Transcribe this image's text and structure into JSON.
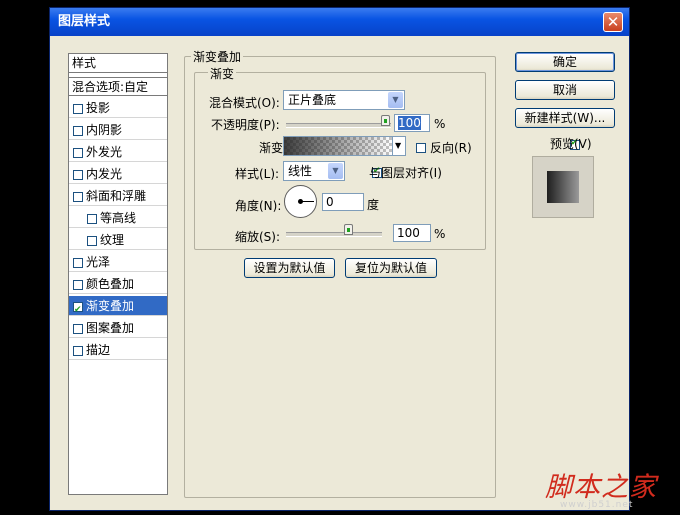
{
  "window": {
    "title": "图层样式",
    "close_glyph": "✕"
  },
  "styles_list": {
    "header": "样式",
    "blend_options": "混合选项:自定",
    "items": [
      {
        "label": "投影",
        "checked": false,
        "sub": false
      },
      {
        "label": "内阴影",
        "checked": false,
        "sub": false
      },
      {
        "label": "外发光",
        "checked": false,
        "sub": false
      },
      {
        "label": "内发光",
        "checked": false,
        "sub": false
      },
      {
        "label": "斜面和浮雕",
        "checked": false,
        "sub": false
      },
      {
        "label": "等高线",
        "checked": false,
        "sub": true
      },
      {
        "label": "纹理",
        "checked": false,
        "sub": true
      },
      {
        "label": "光泽",
        "checked": false,
        "sub": false
      },
      {
        "label": "颜色叠加",
        "checked": false,
        "sub": false
      },
      {
        "label": "渐变叠加",
        "checked": true,
        "sub": false,
        "selected": true
      },
      {
        "label": "图案叠加",
        "checked": false,
        "sub": false
      },
      {
        "label": "描边",
        "checked": false,
        "sub": false
      }
    ]
  },
  "panel": {
    "group_title": "渐变叠加",
    "inner_group_title": "渐变",
    "blend_mode_label": "混合模式(O):",
    "blend_mode_value": "正片叠底",
    "opacity_label": "不透明度(P):",
    "opacity_value": "100",
    "opacity_unit": "%",
    "gradient_label": "渐变:",
    "reverse_label": "反向(R)",
    "reverse_checked": false,
    "style_label": "样式(L):",
    "style_value": "线性",
    "align_label": "与图层对齐(I)",
    "align_checked": true,
    "angle_label": "角度(N):",
    "angle_value": "0",
    "angle_unit": "度",
    "scale_label": "缩放(S):",
    "scale_value": "100",
    "scale_unit": "%",
    "set_default_button": "设置为默认值",
    "reset_default_button": "复位为默认值"
  },
  "side_buttons": {
    "ok": "确定",
    "cancel": "取消",
    "new_style": "新建样式(W)...",
    "preview_label": "预览(V)",
    "preview_checked": true
  },
  "watermark": {
    "text": "脚本之家",
    "url": "www.jb51.net"
  },
  "colors": {
    "title_bar": "#0954e3",
    "selection": "#316ac5",
    "dialog_bg": "#ece9d8",
    "watermark": "#d12b1d"
  }
}
